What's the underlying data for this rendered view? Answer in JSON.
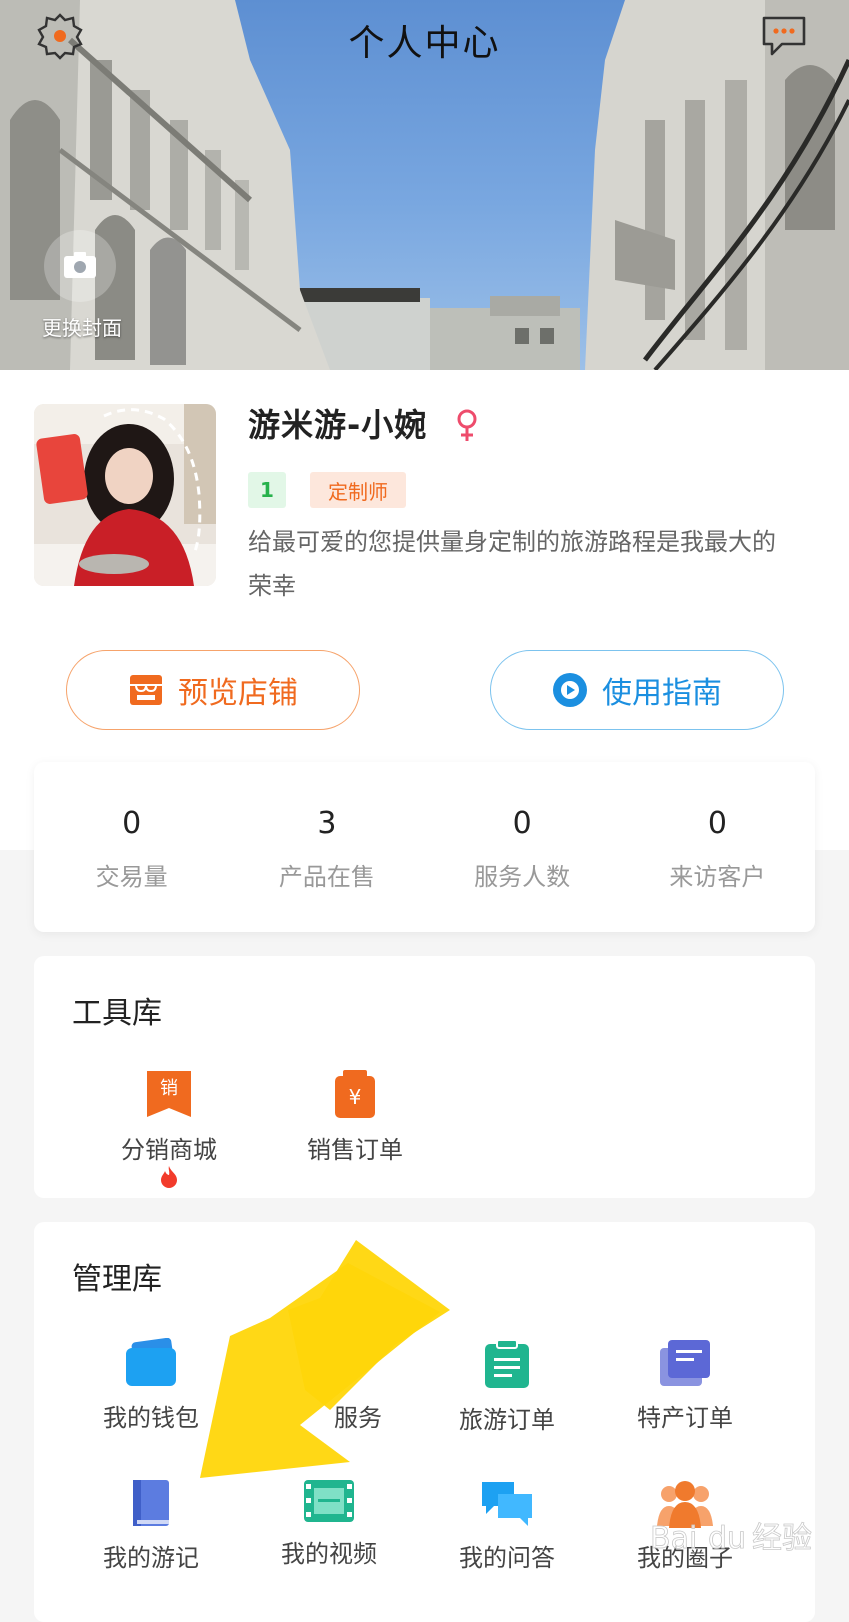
{
  "header": {
    "title": "个人中心",
    "change_cover_label": "更换封面"
  },
  "profile": {
    "name": "游米游-小婉",
    "level": "1",
    "role_badge": "定制师",
    "bio": "给最可爱的您提供量身定制的旅游路程是我最大的荣幸"
  },
  "actions": {
    "preview_shop": "预览店铺",
    "user_guide": "使用指南"
  },
  "stats": [
    {
      "value": "0",
      "label": "交易量"
    },
    {
      "value": "3",
      "label": "产品在售"
    },
    {
      "value": "0",
      "label": "服务人数"
    },
    {
      "value": "0",
      "label": "来访客户"
    }
  ],
  "toolbox": {
    "title": "工具库",
    "items": [
      {
        "label": "分销商城",
        "icon": "sales-tag-icon",
        "hot": true,
        "icon_text": "销"
      },
      {
        "label": "销售订单",
        "icon": "yuan-bag-icon",
        "icon_text": "¥"
      }
    ]
  },
  "management": {
    "title": "管理库",
    "items": [
      {
        "label": "我的钱包",
        "icon": "wallet-icon"
      },
      {
        "label": "服务",
        "icon": "service-icon"
      },
      {
        "label": "旅游订单",
        "icon": "clipboard-icon"
      },
      {
        "label": "特产订单",
        "icon": "stacked-docs-icon"
      },
      {
        "label": "我的游记",
        "icon": "notebook-icon"
      },
      {
        "label": "我的视频",
        "icon": "film-icon"
      },
      {
        "label": "我的问答",
        "icon": "chat-bubbles-icon"
      },
      {
        "label": "我的圈子",
        "icon": "people-icon"
      }
    ]
  },
  "colors": {
    "orange": "#f06a1f",
    "blue": "#1b8fe0",
    "green": "#27b24c",
    "arrow_yellow": "#ffd60a"
  }
}
